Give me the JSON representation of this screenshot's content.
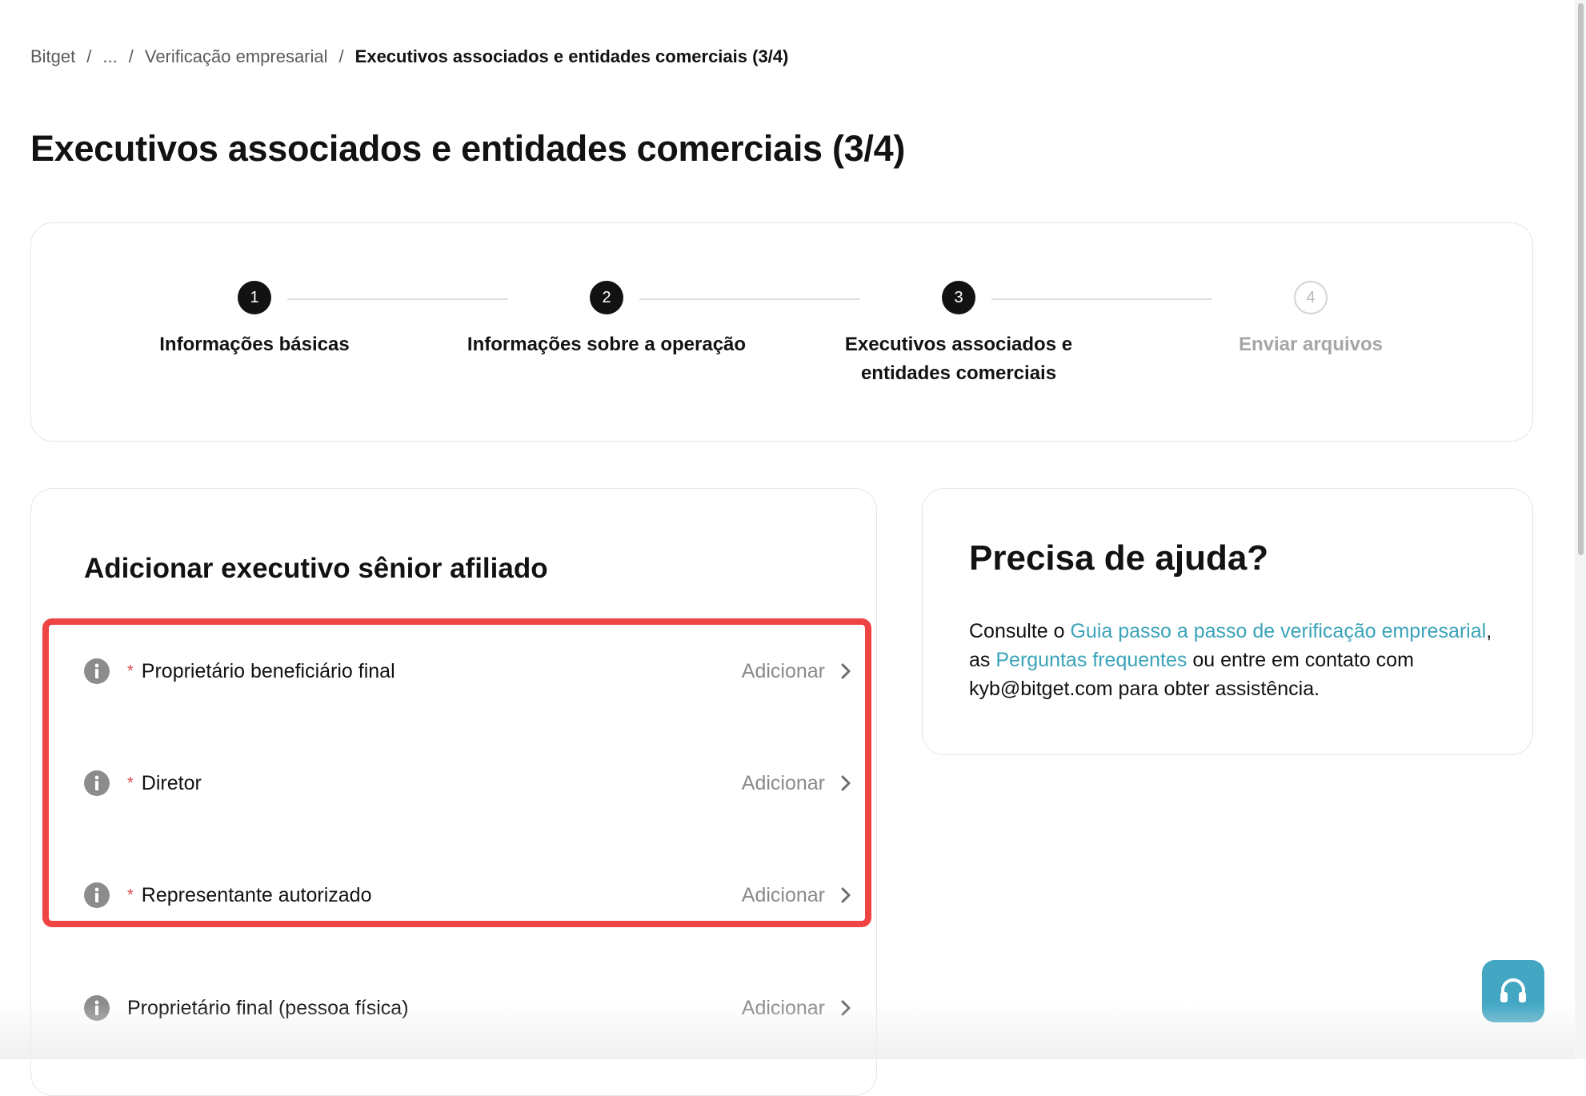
{
  "breadcrumb": {
    "items": [
      "Bitget",
      "...",
      "Verificação empresarial"
    ],
    "current": "Executivos associados e entidades comerciais (3/4)",
    "separator": "/"
  },
  "page": {
    "title": "Executivos associados e entidades comerciais (3/4)"
  },
  "stepper": {
    "steps": [
      {
        "number": "1",
        "label": "Informações básicas",
        "status": "done"
      },
      {
        "number": "2",
        "label": "Informações sobre a operação",
        "status": "done"
      },
      {
        "number": "3",
        "label_line1": "Executivos associados e",
        "label_line2": "entidades comerciais",
        "status": "current"
      },
      {
        "number": "4",
        "label": "Enviar arquivos",
        "status": "pending"
      }
    ]
  },
  "form": {
    "section_title": "Adicionar executivo sênior afiliado",
    "required_marker": "*",
    "rows": [
      {
        "label": "Proprietário beneficiário final",
        "required": true,
        "action": "Adicionar"
      },
      {
        "label": "Diretor",
        "required": true,
        "action": "Adicionar"
      },
      {
        "label": "Representante autorizado",
        "required": true,
        "action": "Adicionar"
      },
      {
        "label": "Proprietário final (pessoa física)",
        "required": false,
        "action": "Adicionar"
      }
    ]
  },
  "help": {
    "title": "Precisa de ajuda?",
    "text_1": "Consulte o ",
    "link_guide": "Guia passo a passo de verificação empresarial",
    "text_2": ", as ",
    "link_faq": "Perguntas frequentes",
    "text_3": " ou entre em contato com kyb@bitget.com para obter assistência."
  },
  "colors": {
    "accent_link": "#3aa3b9",
    "highlight_border": "#ef4444",
    "support_button": "#43a7c4",
    "step_done": "#121212"
  },
  "icons": {
    "info": "info-circle-icon",
    "chevron": "chevron-right-icon",
    "support": "headset-icon"
  }
}
